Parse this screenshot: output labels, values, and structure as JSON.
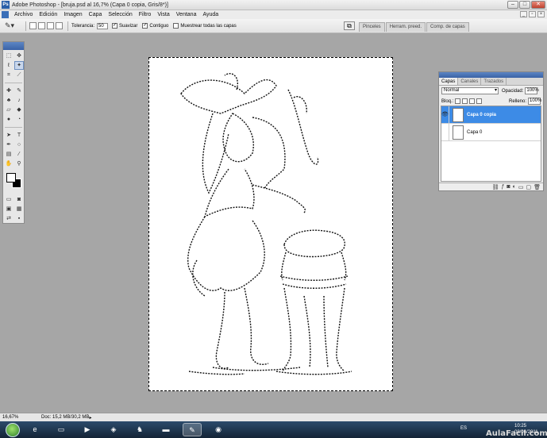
{
  "window": {
    "title": "Adobe Photoshop - [bruja.psd al 16,7% (Capa 0 copia, Gris/8*)]"
  },
  "menu": [
    "Archivo",
    "Edición",
    "Imagen",
    "Capa",
    "Selección",
    "Filtro",
    "Vista",
    "Ventana",
    "Ayuda"
  ],
  "options": {
    "tolerance_label": "Tolerancia:",
    "tolerance_value": "50",
    "antialias_label": "Suavizar",
    "contiguous_label": "Contiguo",
    "all_layers_label": "Muestrear todas las capas"
  },
  "palette_well_tabs": [
    "Pinceles",
    "Herram. preed.",
    "Comp. de capas"
  ],
  "layers_panel": {
    "tabs": [
      "Capas",
      "Canales",
      "Trazados"
    ],
    "blend_mode": "Normal",
    "opacity_label": "Opacidad:",
    "opacity_value": "100%",
    "lock_label": "Bloq.:",
    "fill_label": "Relleno:",
    "fill_value": "100%",
    "layers": [
      {
        "name": "Capa 0 copia",
        "visible": true,
        "selected": true
      },
      {
        "name": "Capa 0",
        "visible": false,
        "selected": false
      }
    ]
  },
  "status": {
    "zoom": "16,67%",
    "doc_info": "Doc: 15,2 MB/30,2 MB"
  },
  "taskbar": {
    "language": "ES",
    "time": "10:25",
    "date": "08/06/2011",
    "watermark": "AulaFacil.com"
  }
}
